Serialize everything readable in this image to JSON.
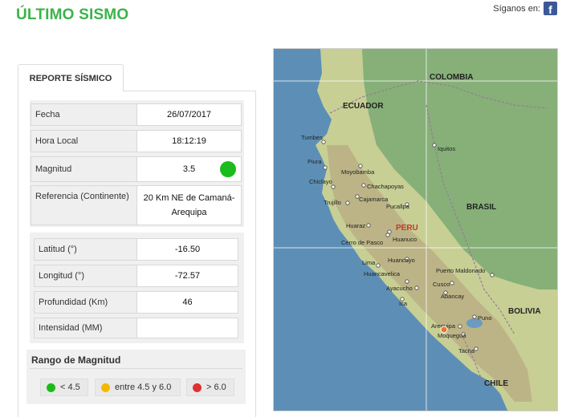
{
  "header": {
    "title": "ÚLTIMO SISMO",
    "follow_label": "Síganos en:",
    "facebook_glyph": "f"
  },
  "tab": {
    "label": "REPORTE SÍSMICO"
  },
  "report": {
    "fecha_label": "Fecha",
    "fecha_value": "26/07/2017",
    "hora_label": "Hora Local",
    "hora_value": "18:12:19",
    "magnitud_label": "Magnitud",
    "magnitud_value": "3.5",
    "magnitud_color": "#1bbb1b",
    "referencia_label": "Referencia (Continente)",
    "referencia_line1": "20 Km NE de Camaná-",
    "referencia_line2": "Arequipa"
  },
  "details": {
    "latitud_label": "Latitud (°)",
    "latitud_value": "-16.50",
    "longitud_label": "Longitud (°)",
    "longitud_value": "-72.57",
    "profundidad_label": "Profundidad (Km)",
    "profundidad_value": "46",
    "intensidad_label": "Intensidad (MM)",
    "intensidad_value": ""
  },
  "range": {
    "title": "Rango de Magnitud",
    "items": [
      {
        "label": "< 4.5",
        "color": "#1bbb1b"
      },
      {
        "label": "entre 4.5 y 6.0",
        "color": "#f5b800"
      },
      {
        "label": "> 6.0",
        "color": "#e03030"
      }
    ]
  },
  "map": {
    "countries": {
      "colombia": "COLOMBIA",
      "ecuador": "ECUADOR",
      "brasil": "BRASIL",
      "peru": "PERU",
      "bolivia": "BOLIVIA",
      "chile": "CHILE"
    },
    "cities": {
      "tumbes": "Tumbes",
      "iquitos": "Iquitos",
      "piura": "Piura",
      "moyobamba": "Moyobamba",
      "chiclayo": "Chiclayo",
      "chachapoyas": "Chachapoyas",
      "trujillo": "Trujillo",
      "cajamarca": "Cajamarca",
      "pucallpa": "Pucallpa",
      "huaraz": "Huaraz",
      "cerro_de_pasco": "Cerro de Pasco",
      "huanuco": "Huanuco",
      "huancayo": "Huancayo",
      "lima": "Lima",
      "huancavelica": "Huancavelica",
      "puerto_maldonado": "Puerto Maldonado",
      "ayacucho": "Ayacucho",
      "cusco": "Cusco",
      "abancay": "Abancay",
      "ica": "Ica",
      "puno": "Puno",
      "arequipa": "Arequipa",
      "moquegua": "Moquegua",
      "tacna": "Tacna"
    },
    "epicenter_color": "#e8762a"
  }
}
